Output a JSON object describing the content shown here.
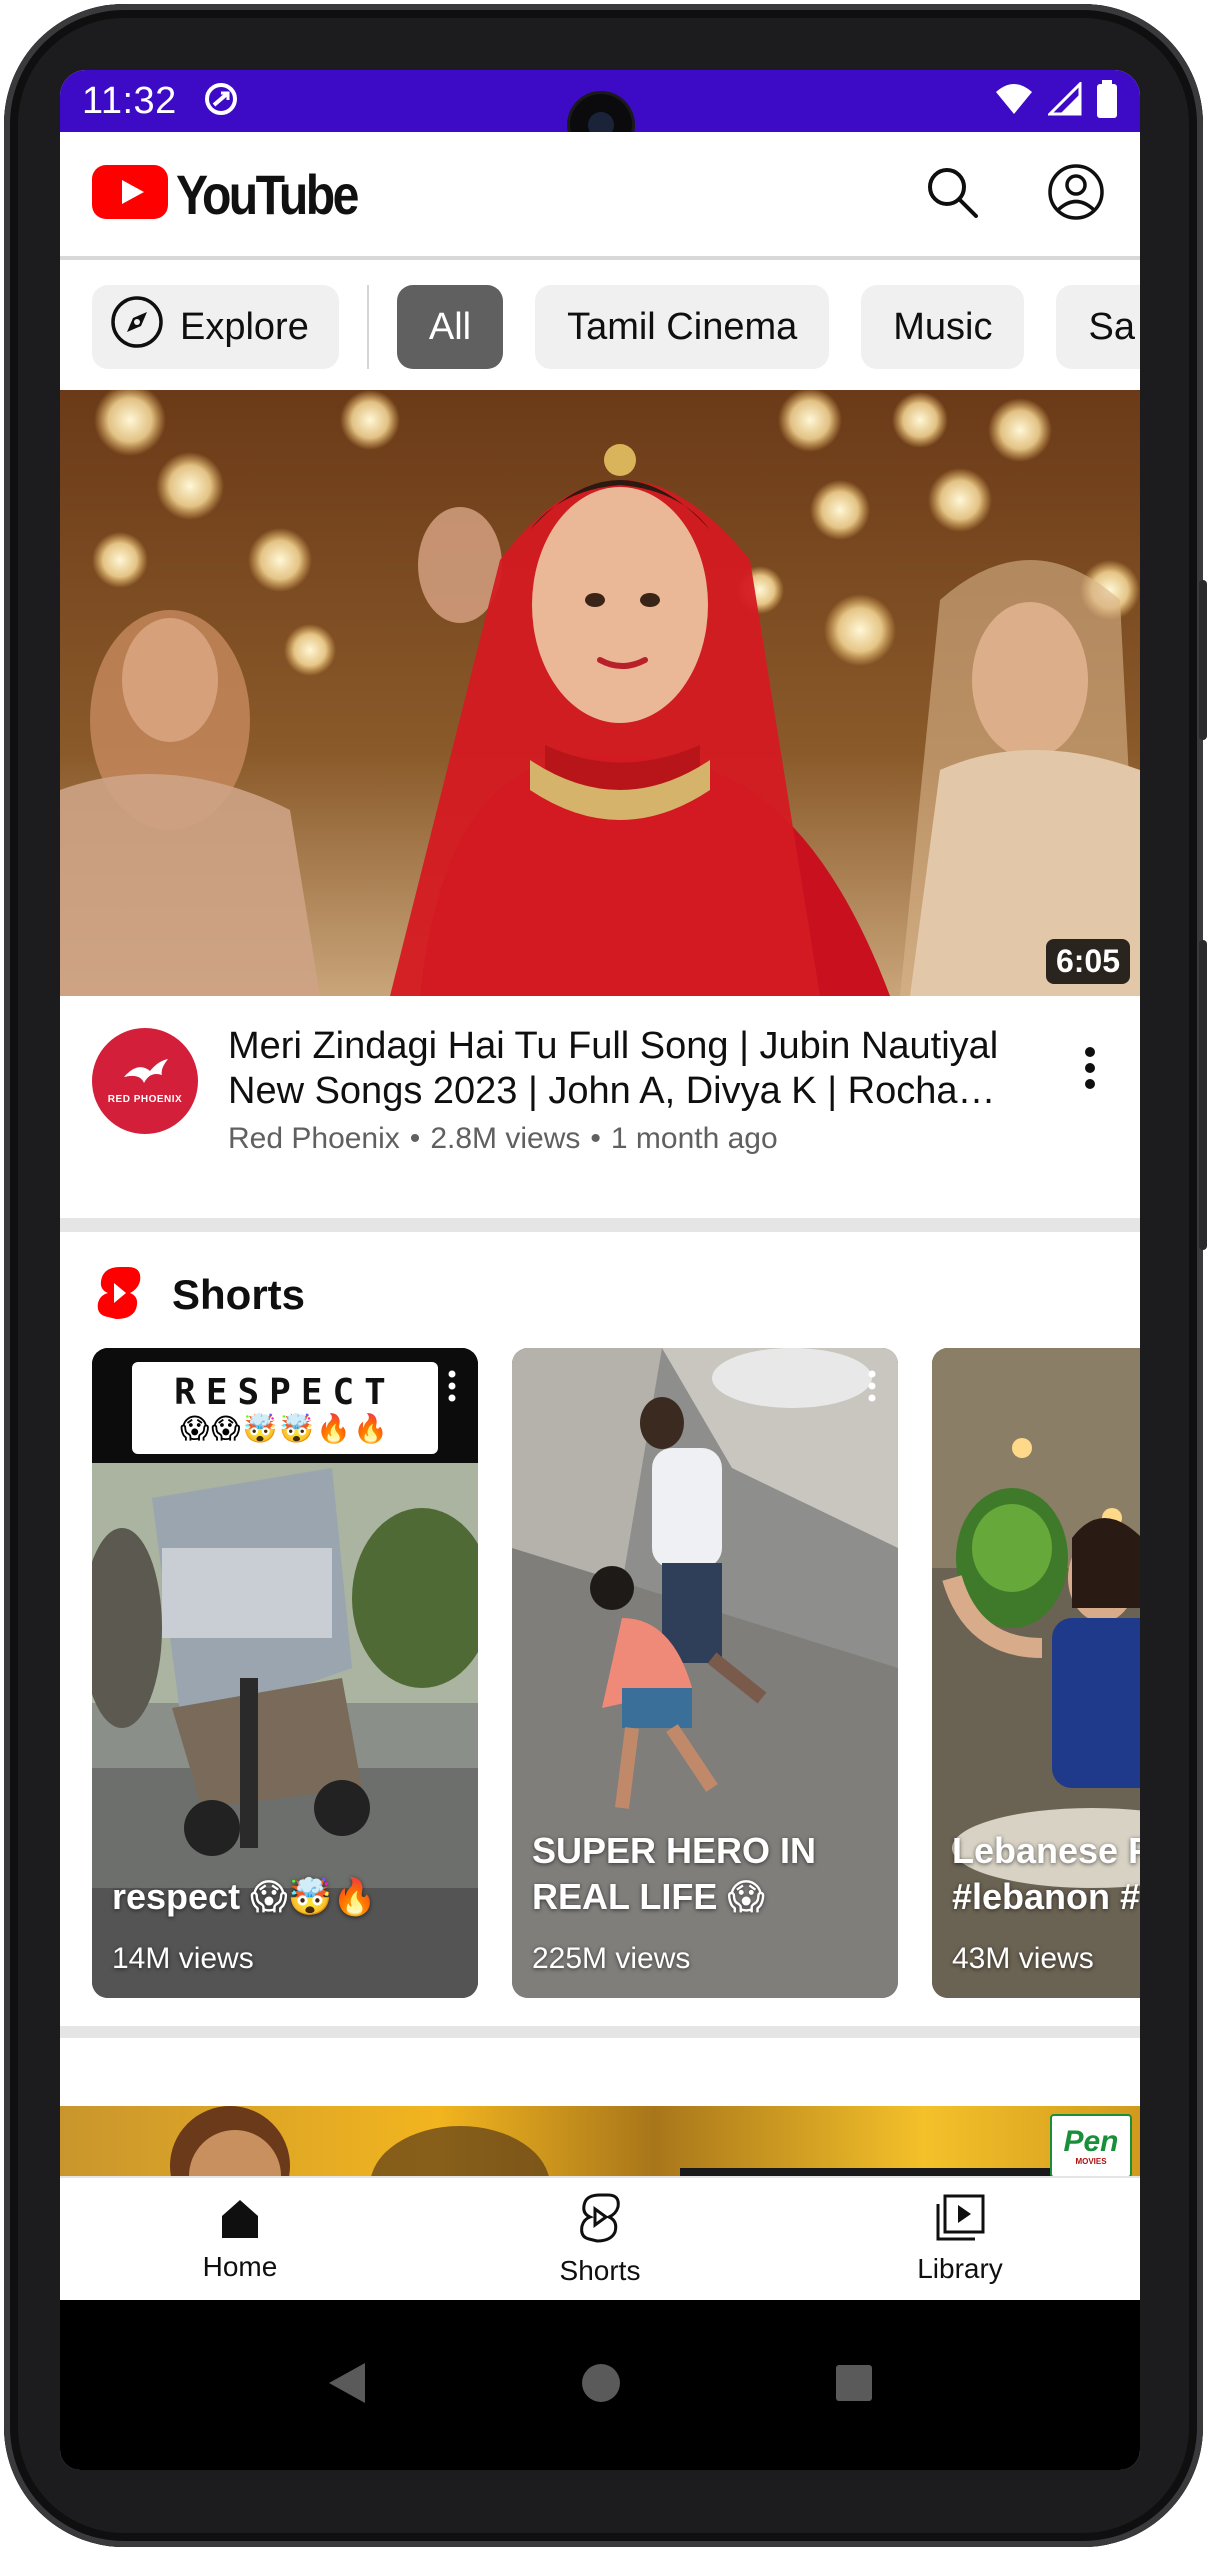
{
  "status_bar": {
    "time": "11:32"
  },
  "app_bar": {
    "logo_text": "YouTube",
    "search_icon": "search-icon",
    "account_icon": "account-circle-icon"
  },
  "chips": {
    "explore": "Explore",
    "items": [
      "All",
      "Tamil Cinema",
      "Music",
      "Sa"
    ],
    "active": "All"
  },
  "featured_video": {
    "duration": "6:05",
    "title": "Meri Zindagi Hai Tu Full Song | Jubin Nautiyal New Songs 2023 | John A, Divya K | Rochak ft...",
    "channel": "Red Phoenix",
    "views": "2.8M views",
    "age": "1 month ago",
    "separator": "•",
    "avatar_text": "RED PHOENIX"
  },
  "shorts": {
    "section_title": "Shorts",
    "items": [
      {
        "banner_text": "RESPECT",
        "banner_emoji": "😱😱🤯🤯🔥🔥",
        "caption": "respect 😱🤯🔥",
        "views": "14M views"
      },
      {
        "caption": "SUPER HERO IN REAL LIFE 😱",
        "views": "225M views"
      },
      {
        "caption": "Lebanese F #lebanon #",
        "views": "43M views"
      }
    ]
  },
  "next_video": {
    "channel_logo_text": "Pen",
    "channel_logo_sub": "MOVIES"
  },
  "bottom_nav": {
    "home": "Home",
    "shorts": "Shorts",
    "library": "Library"
  },
  "colors": {
    "status_bar": "#3d0bc5",
    "youtube_red": "#ff0000",
    "chip_active": "#606060",
    "chip_bg": "#f0f0f0",
    "text_secondary": "#606060"
  }
}
